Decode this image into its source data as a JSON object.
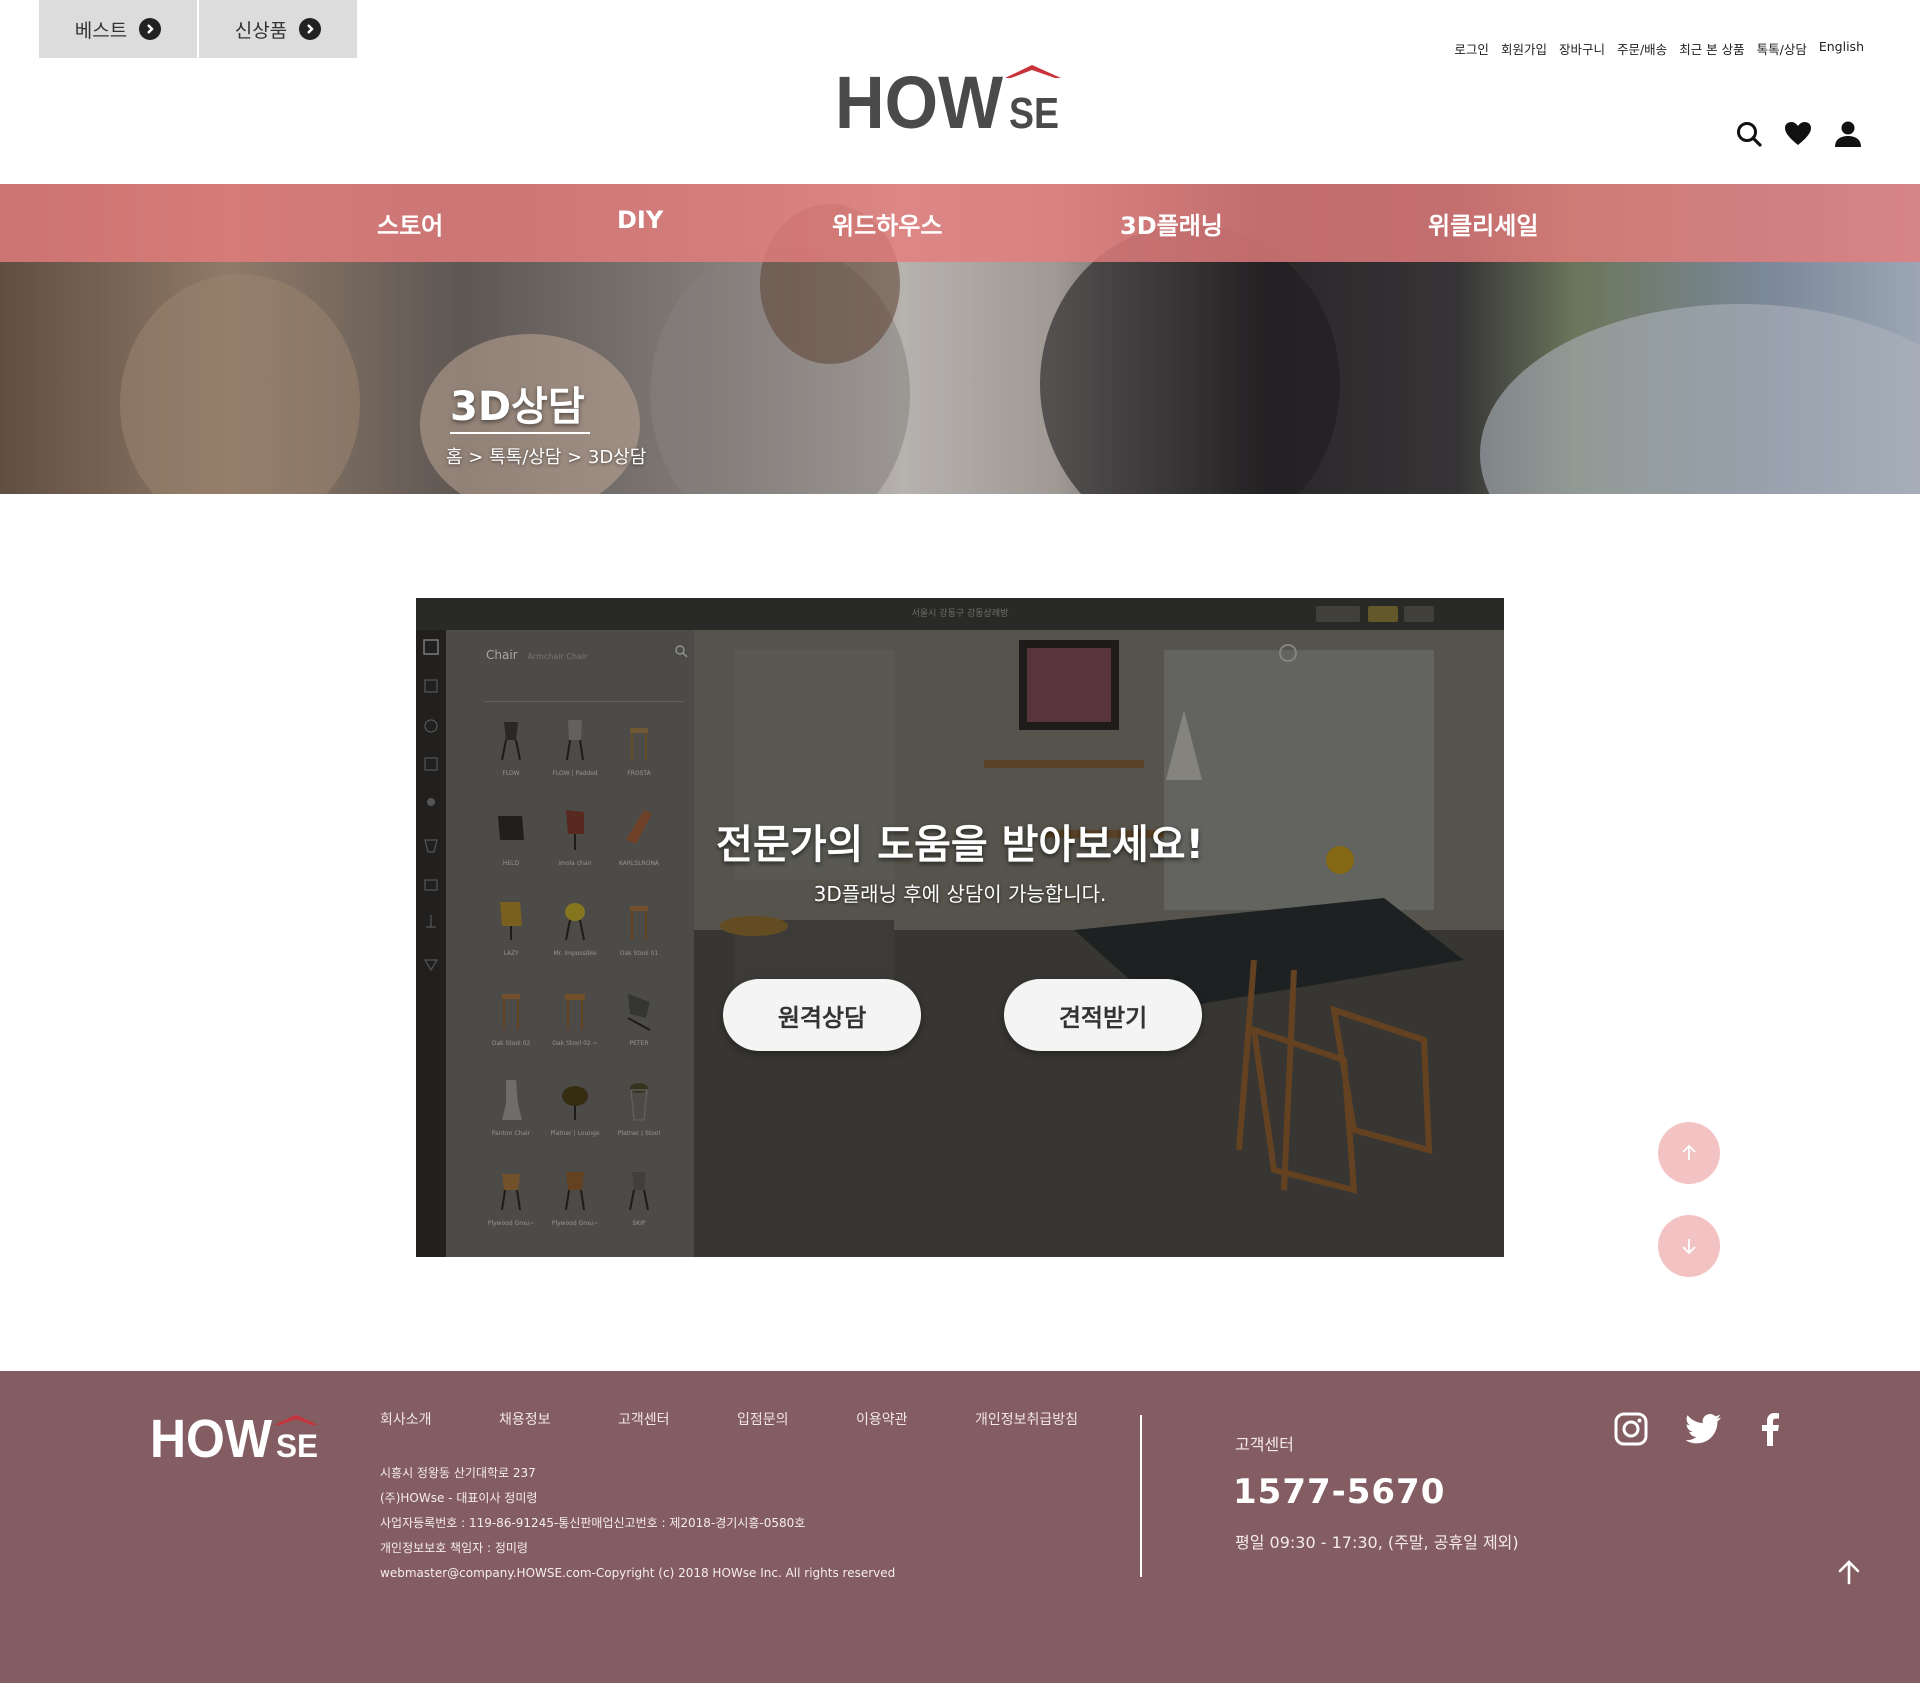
{
  "header": {
    "quick_tabs": [
      {
        "label": "베스트"
      },
      {
        "label": "신상품"
      }
    ],
    "logo_text": "HOWSE",
    "utility_links": [
      "로그인",
      "회원가입",
      "장바구니",
      "주문/배송",
      "최근 본 상품",
      "톡톡/상담",
      "English"
    ],
    "icons": [
      "search-icon",
      "heart-icon",
      "user-icon"
    ]
  },
  "nav": {
    "items": [
      "스토어",
      "DIY",
      "위드하우스",
      "3D플래닝",
      "위클리세일"
    ]
  },
  "hero": {
    "title": "3D상담",
    "breadcrumb": "홈 > 톡톡/상담 > 3D상담"
  },
  "consult": {
    "headline": "전문가의 도움을 받아보세요!",
    "subtext": "3D플래닝 후에 상담이 가능합니다.",
    "buttons": [
      "원격상담",
      "견적받기"
    ],
    "app_title": "서울시 강동구 강동상례방",
    "sidebar_heading": "Chair",
    "sidebar_heading_hint": "Armchair Chair",
    "chairs": [
      "FLOW",
      "FLOW | Padded",
      "FROSTA",
      "HELD",
      "imola chair",
      "KARLSLRONA",
      "LAZY",
      "Mr. Impossible",
      "Oak Stool 01",
      "Oak Stool 02",
      "Oak Stool 02 ~",
      "PETER",
      "Panton Chair",
      "Platner | Lounge",
      "Platner | Stool",
      "Plywood Grou~",
      "Plywood Grou~",
      "SKIP"
    ]
  },
  "floating": {
    "icons": [
      "arrow-up-icon",
      "arrow-down-icon"
    ]
  },
  "footer": {
    "logo_text": "HOWSE",
    "links": [
      "회사소개",
      "채용정보",
      "고객센터",
      "입점문의",
      "이용약관",
      "개인정보취급방침"
    ],
    "info": [
      "시흥시 정왕동 산기대학로 237",
      "(주)HOWse - 대표이사 정미령",
      "사업자등록번호 : 119-86-91245-통신판매업신고번호 : 제2018-경기시흥-0580호",
      "개인정보보호 책임자 : 정미령",
      "webmaster@company.HOWSE.com-Copyright (c) 2018 HOWse Inc. All rights reserved"
    ],
    "cs_label": "고객센터",
    "cs_phone": "1577-5670",
    "cs_hours": "평일 09:30 - 17:30,  (주말, 공휴일 제외)",
    "social_icons": [
      "instagram-icon",
      "twitter-icon",
      "facebook-icon"
    ]
  },
  "colors": {
    "nav_pink": "#e47c7c",
    "footer_bg": "#835d61",
    "float_btn": "#f3c3c3",
    "logo_red": "#c8323a",
    "logo_gray": "#4a4a4a"
  }
}
